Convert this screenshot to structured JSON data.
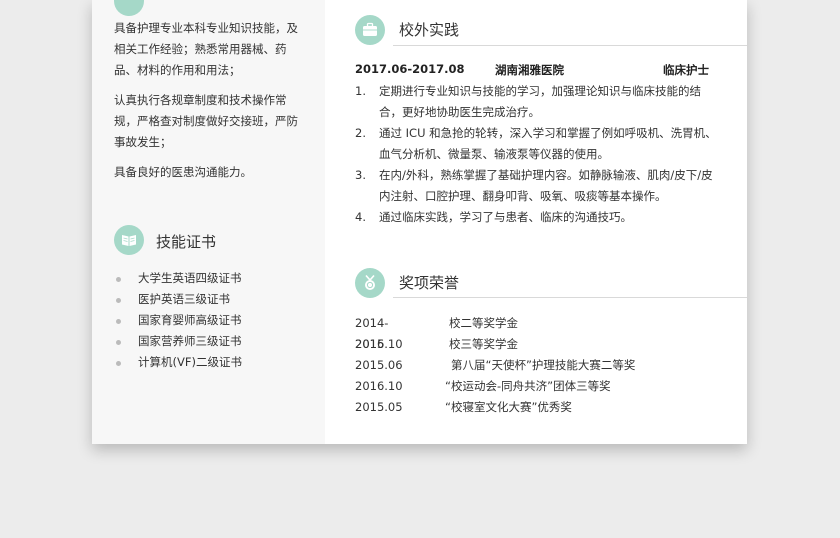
{
  "left": {
    "paragraphs": [
      "具备护理专业本科专业知识技能，及相关工作经验；熟悉常用器械、药品、材料的作用和用法；",
      "认真执行各规章制度和技术操作常规，严格查对制度做好交接班，严防事故发生；",
      "具备良好的医患沟通能力。"
    ],
    "skills": {
      "title": "技能证书",
      "icon": "book-icon",
      "items": [
        "大学生英语四级证书",
        "医护英语三级证书",
        "国家育婴师高级证书",
        "国家营养师三级证书",
        "计算机(VF)二级证书"
      ]
    }
  },
  "right": {
    "practice": {
      "title": "校外实践",
      "icon": "briefcase-icon",
      "period": "2017.06-2017.08",
      "hospital": "湖南湘雅医院",
      "role": "临床护士",
      "items": [
        {
          "num": "1.",
          "text": "定期进行专业知识与技能的学习，加强理论知识与临床技能的结合，更好地协助医生完成治疗。"
        },
        {
          "num": "2.",
          "text": "通过 ICU 和急抢的轮转，深入学习和掌握了例如呼吸机、洗胃机、血气分析机、微量泵、输液泵等仪器的使用。"
        },
        {
          "num": "3.",
          "text": "在内/外科，熟练掌握了基础护理内容。如静脉输液、肌肉/皮下/皮内注射、口腔护理、翻身叩背、吸氧、吸痰等基本操作。"
        },
        {
          "num": "4.",
          "text": "通过临床实践，学习了与患者、临床的沟通技巧。"
        }
      ]
    },
    "awards": {
      "title": "奖项荣誉",
      "icon": "medal-icon",
      "items": [
        {
          "date": "2014-2015",
          "name": "校二等奖学金"
        },
        {
          "date": "2016.10",
          "name": "校三等奖学金"
        },
        {
          "date": "2015.06",
          "name": "第八届“天使杯”护理技能大赛二等奖"
        },
        {
          "date": "2016.10",
          "name": "“校运动会-同舟共济”团体三等奖"
        },
        {
          "date": "2015.05",
          "name": "“校寝室文化大赛”优秀奖"
        }
      ]
    }
  },
  "colors": {
    "accent": "#a5d8c8",
    "background": "#ececec",
    "sidebar": "#f7f7f7"
  }
}
